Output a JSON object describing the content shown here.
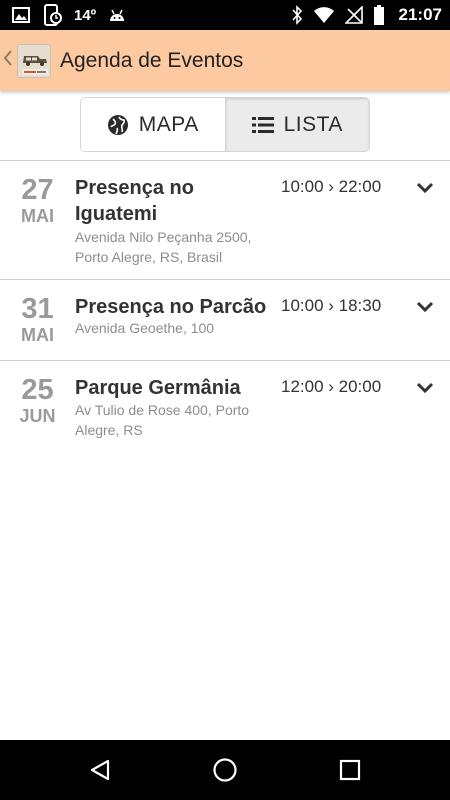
{
  "status_bar": {
    "temperature": "14º",
    "time": "21:07",
    "icons": [
      "picture-icon",
      "phone-sync-icon",
      "android-icon",
      "bluetooth-icon",
      "wifi-icon",
      "no-signal-icon",
      "battery-icon"
    ]
  },
  "app_bar": {
    "title": "Agenda de Eventos",
    "back_icon": "chevron-left-icon",
    "logo_text": "FOOD TRUCKS"
  },
  "view_toggle": {
    "map_label": "MAPA",
    "list_label": "LISTA",
    "active": "list"
  },
  "events": [
    {
      "day": "27",
      "month": "MAI",
      "title": "Presença no Iguatemi",
      "address": "Avenida Nilo Peçanha 2500, Porto Alegre, RS, Brasil",
      "time": "10:00 › 22:00"
    },
    {
      "day": "31",
      "month": "MAI",
      "title": "Presença no Parcão",
      "address": "Avenida Geoethe, 100",
      "time": "10:00 › 18:30"
    },
    {
      "day": "25",
      "month": "JUN",
      "title": "Parque Germânia",
      "address": "Av Tulio de Rose 400, Porto Alegre, RS",
      "time": "12:00 › 20:00"
    }
  ],
  "nav_bar": {
    "icons": [
      "back-triangle-icon",
      "home-circle-icon",
      "recents-square-icon"
    ]
  },
  "colors": {
    "app_bar": "#fdc9a0",
    "date_text": "#9a9a9a",
    "address_text": "#8d8d8d"
  }
}
